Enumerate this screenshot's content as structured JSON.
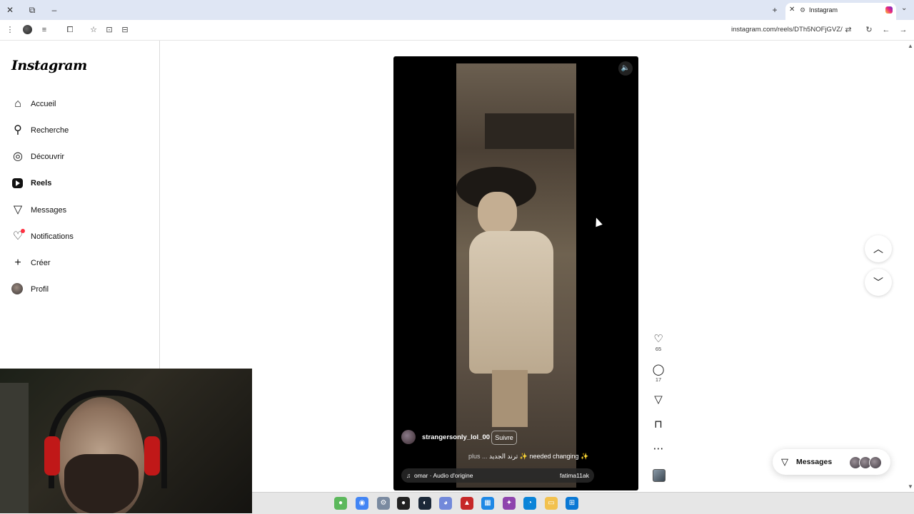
{
  "browser": {
    "tab_title": "Instagram",
    "url": "instagram.com/reels/DTh5NOFjGVZ/",
    "window_close": "✕",
    "window_restore": "⧉",
    "window_min": "–",
    "new_tab": "+",
    "tab_close": "✕",
    "tab_list": "⌄"
  },
  "sidebar": {
    "logo": "Instagram",
    "items": [
      {
        "label": "Accueil",
        "icon": "home-icon"
      },
      {
        "label": "Recherche",
        "icon": "search-icon"
      },
      {
        "label": "Découvrir",
        "icon": "compass-icon"
      },
      {
        "label": "Reels",
        "icon": "reels-icon"
      },
      {
        "label": "Messages",
        "icon": "paper-plane-icon"
      },
      {
        "label": "Notifications",
        "icon": "heart-icon"
      },
      {
        "label": "Créer",
        "icon": "plus-icon"
      },
      {
        "label": "Profil",
        "icon": "profile-avatar"
      }
    ]
  },
  "reel": {
    "username": "strangersonly_lol_00",
    "follow_label": "Suivre",
    "caption": "ترند الجديد ✨ needed changing ✨",
    "more_label": "plus ...",
    "audio_text": "omar · Audio d'origine",
    "audio_user": "fatima11ak"
  },
  "actions": {
    "likes": "65",
    "comments": "17"
  },
  "messages_pill": {
    "label": "Messages"
  }
}
